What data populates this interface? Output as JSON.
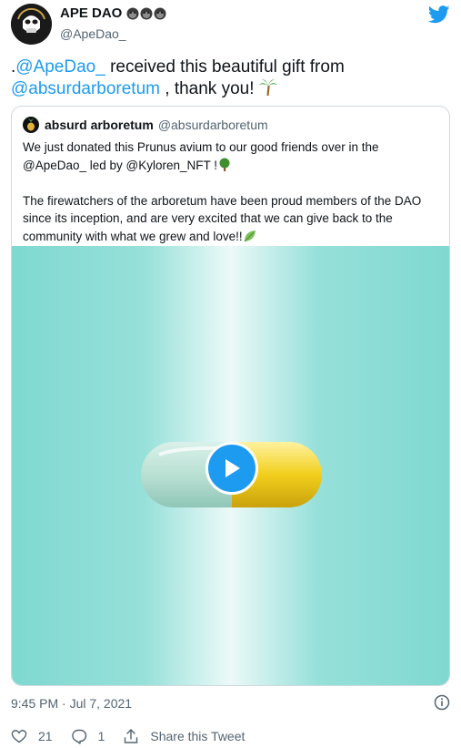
{
  "header": {
    "display_name": "APE DAO",
    "handle": "@ApeDao_",
    "name_emojis": [
      "ape-face-emoji",
      "ape-face-emoji",
      "ape-face-emoji"
    ],
    "brand_color": "#1d9bf0"
  },
  "tweet": {
    "prefix": ".",
    "mention1": "@ApeDao_",
    "text_mid": "  received this beautiful gift from",
    "mention2": "@absurdarboretum",
    "text_end": " , thank you! ",
    "emoji": "palm-tree-emoji"
  },
  "quote": {
    "name": "absurd arboretum",
    "handle": "@absurdarboretum",
    "line1": "We just donated this Prunus avium to our good friends over in the",
    "line2": "@ApeDao_ led by @Kyloren_NFT !",
    "line2_emoji": "tree-emoji",
    "para2": "The firewatchers of the arboretum have been proud members of the DAO since its inception, and are very excited that we can give back to the community with what we grew and love!!",
    "para2_emoji": "leaf-emoji",
    "video_bg": "#7fd9d1"
  },
  "footer": {
    "timestamp": "9:45 PM · Jul 7, 2021",
    "likes": "21",
    "replies": "1",
    "share_label": "Share this Tweet"
  }
}
